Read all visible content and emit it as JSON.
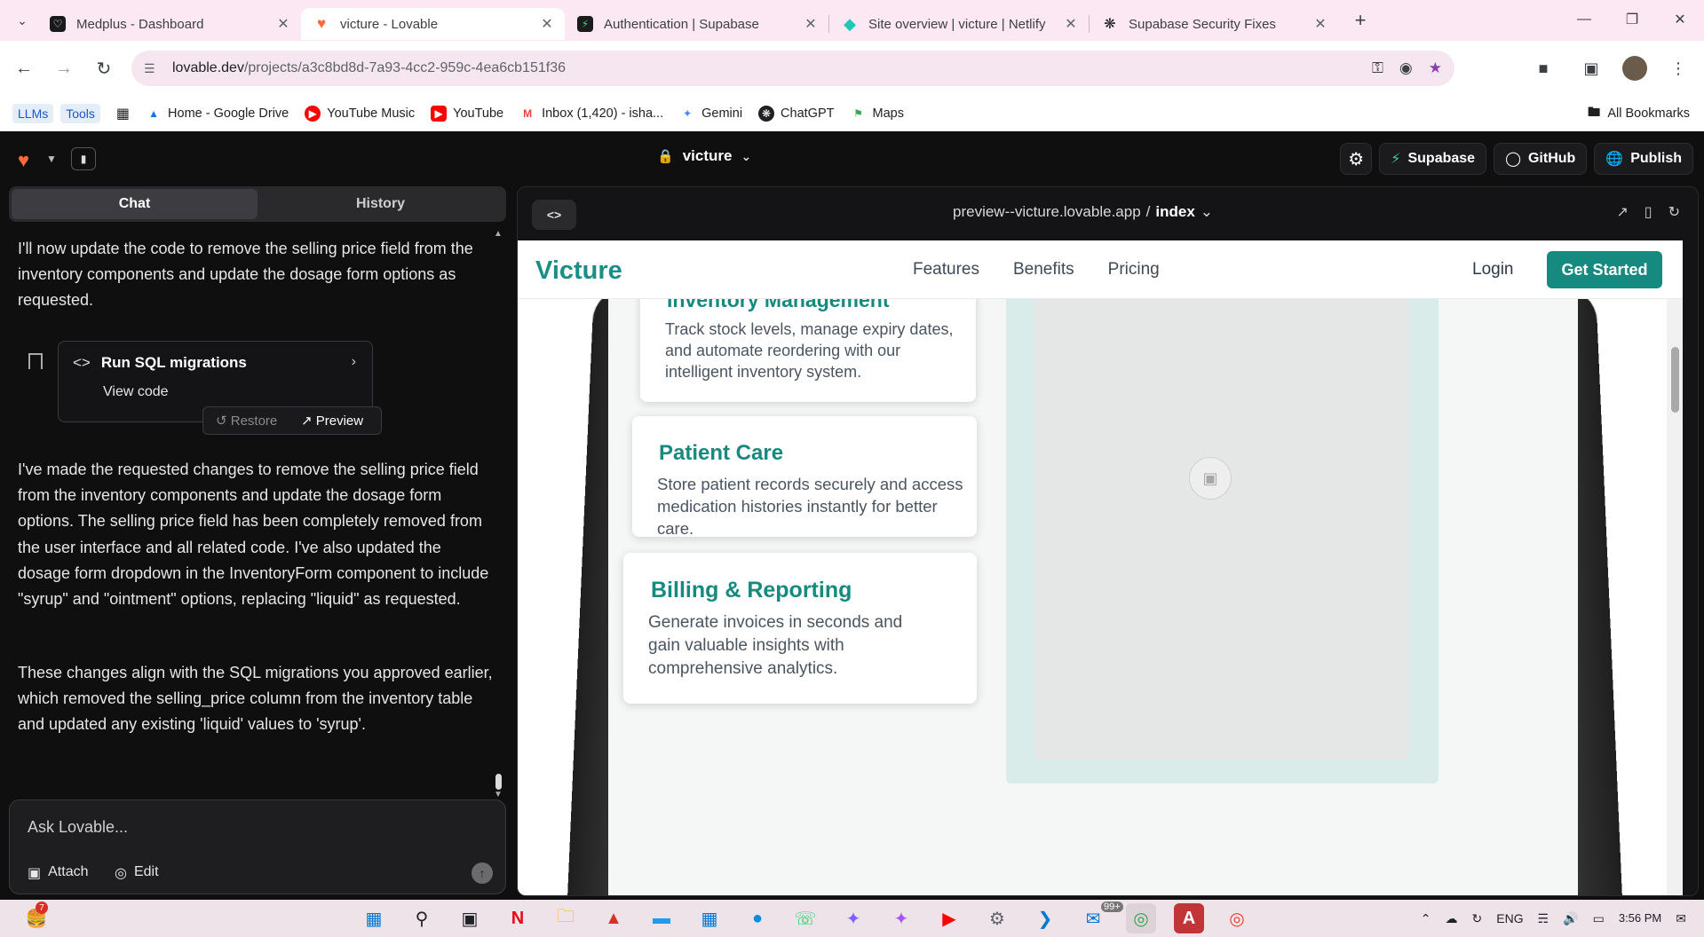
{
  "browser": {
    "tabs": [
      {
        "title": "Medplus - Dashboard",
        "icon": "heart-icon",
        "color": "#1a1a1a"
      },
      {
        "title": "victure - Lovable",
        "icon": "lovable-heart-icon",
        "color": "#ff6a3d"
      },
      {
        "title": "Authentication | Supabase",
        "icon": "supabase-icon",
        "color": "#3ecf8e"
      },
      {
        "title": "Site overview | victure | Netlify",
        "icon": "netlify-icon",
        "color": "#20c6b7"
      },
      {
        "title": "Supabase Security Fixes",
        "icon": "openai-icon",
        "color": "#202124"
      }
    ],
    "url_host": "lovable.dev",
    "url_path": "/projects/a3c8bd8d-7a93-4cc2-959c-4ea6cb151f36",
    "bookmark_chips": [
      "LLMs",
      "Tools"
    ],
    "bookmarks": [
      {
        "label": "Home - Google Drive",
        "icon": "drive-icon"
      },
      {
        "label": "YouTube Music",
        "icon": "youtube-music-icon"
      },
      {
        "label": "YouTube",
        "icon": "youtube-icon"
      },
      {
        "label": "Inbox (1,420) - isha...",
        "icon": "gmail-icon"
      },
      {
        "label": "Gemini",
        "icon": "gemini-icon"
      },
      {
        "label": "ChatGPT",
        "icon": "chatgpt-icon"
      },
      {
        "label": "Maps",
        "icon": "maps-icon"
      }
    ],
    "all_bookmarks": "All Bookmarks"
  },
  "app": {
    "project_name": "victure",
    "actions": {
      "supabase": "Supabase",
      "github": "GitHub",
      "publish": "Publish"
    },
    "chat_tabs": [
      "Chat",
      "History"
    ],
    "message_intro": "I'll now update the code to remove the selling price field from the inventory components and update the dosage form options as requested.",
    "sql_card": {
      "title": "Run SQL migrations",
      "link": "View code",
      "restore": "Restore",
      "preview": "Preview"
    },
    "message_2": "I've made the requested changes to remove the selling price field from the inventory components and update the dosage form options. The selling price field has been completely removed from the user interface and all related code. I've also updated the dosage form dropdown in the InventoryForm component to include \"syrup\" and \"ointment\" options, replacing \"liquid\" as requested.",
    "message_3": "These changes align with the SQL migrations you approved earlier, which removed the selling_price column from the inventory table and updated any existing 'liquid' values to 'syrup'.",
    "input": {
      "placeholder": "Ask Lovable...",
      "attach": "Attach",
      "edit": "Edit"
    }
  },
  "preview": {
    "url": "preview--victure.lovable.app",
    "page": "index",
    "site": {
      "brand": "Victure",
      "nav": [
        "Features",
        "Benefits",
        "Pricing"
      ],
      "login": "Login",
      "cta": "Get Started",
      "features": [
        {
          "title": "Inventory Management",
          "desc": "Track stock levels, manage expiry dates, and automate reordering with our intelligent inventory system."
        },
        {
          "title": "Patient Care",
          "desc": "Store patient records securely and access medication histories instantly for better care."
        },
        {
          "title": "Billing & Reporting",
          "desc": "Generate invoices in seconds and gain valuable insights with comprehensive analytics."
        }
      ],
      "brand_color": "#178a80"
    }
  },
  "taskbar": {
    "language": "ENG",
    "time": "3:56 PM",
    "notif_count": "99+",
    "badge": "7"
  }
}
